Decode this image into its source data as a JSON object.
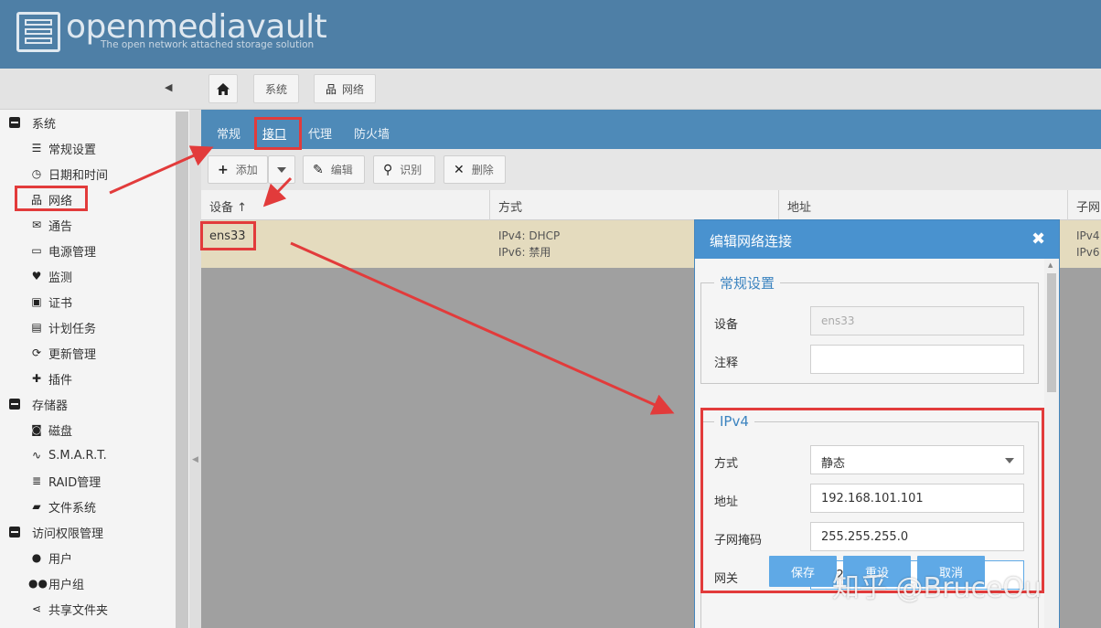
{
  "header": {
    "app_name": "openmediavault",
    "tagline": "The open network attached storage solution"
  },
  "breadcrumb": [
    {
      "label": ""
    },
    {
      "label": "系统"
    },
    {
      "label": "网络"
    }
  ],
  "sidebar": {
    "groups": [
      {
        "label": "系统",
        "items": [
          "常规设置",
          "日期和时间",
          "网络",
          "通告",
          "电源管理",
          "监测",
          "证书",
          "计划任务",
          "更新管理",
          "插件"
        ]
      },
      {
        "label": "存储器",
        "items": [
          "磁盘",
          "S.M.A.R.T.",
          "RAID管理",
          "文件系统"
        ]
      },
      {
        "label": "访问权限管理",
        "items": [
          "用户",
          "用户组",
          "共享文件夹"
        ]
      }
    ]
  },
  "tabs": [
    "常规",
    "接口",
    "代理",
    "防火墙"
  ],
  "toolbar": {
    "add": "添加",
    "edit": "编辑",
    "identify": "识别",
    "delete": "删除"
  },
  "grid": {
    "columns": [
      "设备 ↑",
      "方式",
      "地址",
      "子网"
    ],
    "rows": [
      {
        "device": "ens33",
        "method_ipv4": "IPv4: DHCP",
        "method_ipv6": "IPv6: 禁用",
        "subnet_ipv4": "IPv4",
        "subnet_ipv6": "IPv6"
      }
    ]
  },
  "dialog": {
    "title": "编辑网络连接",
    "general": {
      "legend": "常规设置",
      "device_label": "设备",
      "device_value": "ens33",
      "comment_label": "注释",
      "comment_value": ""
    },
    "ipv4": {
      "legend": "IPv4",
      "method_label": "方式",
      "method_value": "静态",
      "address_label": "地址",
      "address_value": "192.168.101.101",
      "netmask_label": "子网掩码",
      "netmask_value": "255.255.255.0",
      "gateway_label": "网关",
      "gateway_value": "192.168.101.2"
    },
    "buttons": {
      "save": "保存",
      "reset": "重设",
      "cancel": "取消"
    }
  },
  "watermark": "知乎 @BruceOu",
  "colors": {
    "header": "#4e7fa6",
    "tabbar": "#4e8ab8",
    "dialog_header": "#4992cf",
    "button": "#5fa9e6",
    "selected_row": "#e4dbbe",
    "annotation": "#e23b3b"
  }
}
